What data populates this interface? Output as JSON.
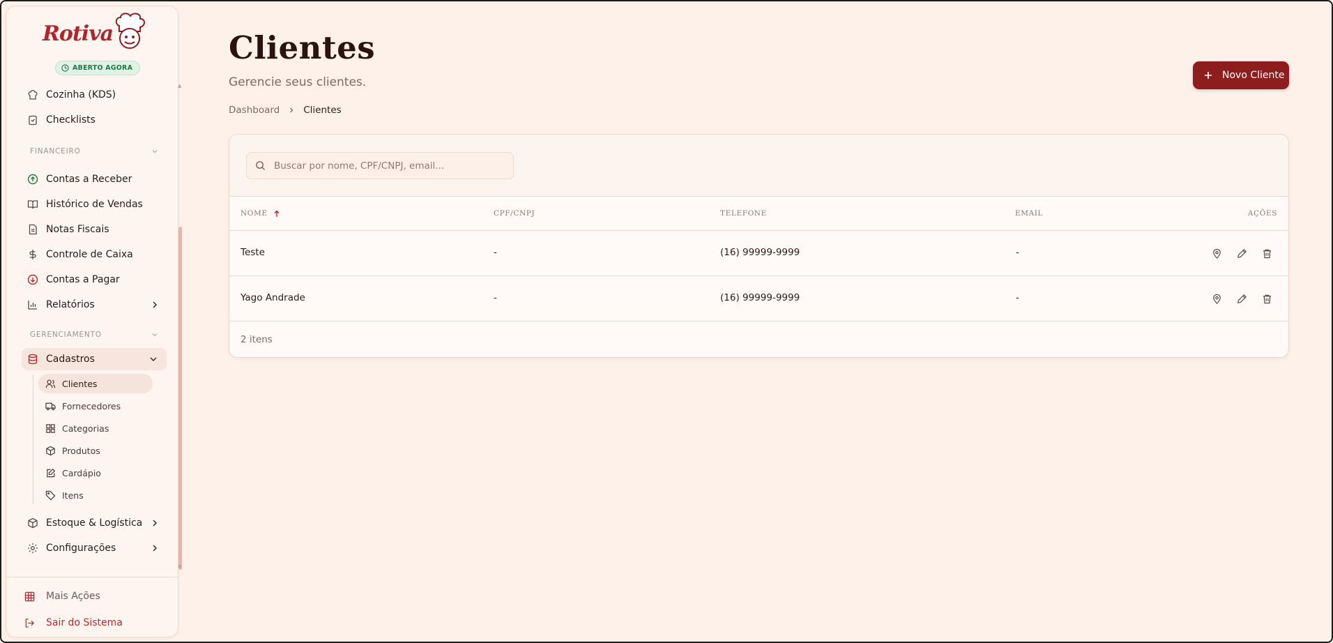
{
  "app": {
    "logo_text": "Rotiva",
    "status": "ABERTO AGORA",
    "colors": {
      "brand": "#8e1d1d",
      "status_green": "#1f7a43",
      "background": "#fef1ea"
    }
  },
  "sidebar": {
    "top_items": [
      {
        "label": "Cozinha (KDS)",
        "icon": "chef-hat-icon"
      },
      {
        "label": "Checklists",
        "icon": "clipboard-check-icon"
      }
    ],
    "financeiro_label": "FINANCEIRO",
    "financeiro_items": [
      {
        "label": "Contas a Receber",
        "icon": "arrow-up-circle-icon"
      },
      {
        "label": "Histórico de Vendas",
        "icon": "book-open-icon"
      },
      {
        "label": "Notas Fiscais",
        "icon": "file-text-icon"
      },
      {
        "label": "Controle de Caixa",
        "icon": "dollar-sign-icon"
      },
      {
        "label": "Contas a Pagar",
        "icon": "arrow-down-circle-icon"
      },
      {
        "label": "Relatórios",
        "icon": "bar-chart-icon"
      }
    ],
    "gerenciamento_label": "GERENCIAMENTO",
    "cadastros": {
      "label": "Cadastros",
      "sub_items": [
        {
          "label": "Clientes",
          "icon": "users-icon"
        },
        {
          "label": "Fornecedores",
          "icon": "truck-icon"
        },
        {
          "label": "Categorias",
          "icon": "grid-icon"
        },
        {
          "label": "Produtos",
          "icon": "package-icon"
        },
        {
          "label": "Cardápio",
          "icon": "edit-square-icon"
        },
        {
          "label": "Itens",
          "icon": "tag-icon"
        }
      ]
    },
    "estoque_label": "Estoque & Logística",
    "config_label": "Configurações",
    "footer": {
      "more_label": "Mais Ações",
      "logout_label": "Sair do Sistema"
    }
  },
  "header": {
    "title": "Clientes",
    "subtitle": "Gerencie seus clientes.",
    "breadcrumb": [
      "Dashboard",
      "Clientes"
    ],
    "new_button": "Novo Cliente"
  },
  "table": {
    "search_placeholder": "Buscar por nome, CPF/CNPJ, email...",
    "columns": [
      "NOME",
      "CPF/CNPJ",
      "TELEFONE",
      "EMAIL",
      "AÇÕES"
    ],
    "rows": [
      {
        "nome": "Teste",
        "cpf": "-",
        "telefone": "(16) 99999-9999",
        "email": "-"
      },
      {
        "nome": "Yago Andrade",
        "cpf": "-",
        "telefone": "(16) 99999-9999",
        "email": "-"
      }
    ],
    "count_label": "2 itens"
  }
}
